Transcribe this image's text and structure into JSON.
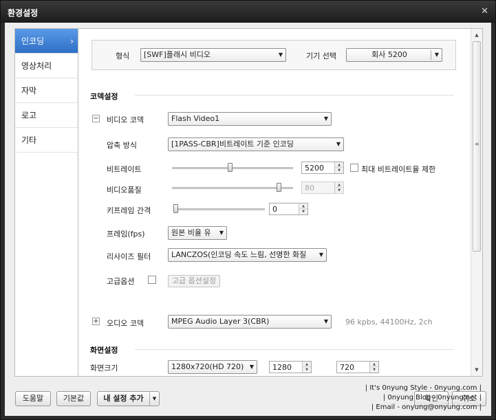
{
  "window": {
    "title": "환경설정",
    "close_icon": "close-icon"
  },
  "sidebar": {
    "items": [
      {
        "label": "인코딩",
        "active": true
      },
      {
        "label": "영상처리"
      },
      {
        "label": "자막"
      },
      {
        "label": "로고"
      },
      {
        "label": "기타"
      }
    ],
    "active_chevron": "›"
  },
  "format": {
    "label": "형식",
    "value": "[SWF]플래시 비디오",
    "device_label": "기기 선택",
    "device_value": "회사 5200"
  },
  "codec_section": {
    "title": "코덱설정",
    "video_codec_toggle": "−",
    "video_codec_label": "비디오 코덱",
    "video_codec_value": "Flash Video1",
    "encoding_method_label": "압축 방식",
    "encoding_method_value": "[1PASS-CBR]비트레이트 기준 인코딩",
    "bitrate_label": "비트레이트",
    "bitrate_value": "5200",
    "bitrate_slider_fraction": 0.48,
    "max_bitrate_label": "최대 비트레이트율 제한",
    "max_bitrate_checked": false,
    "quality_label": "비디오품질",
    "quality_value": "80",
    "quality_slider_fraction": 0.9,
    "keyframe_label": "키프레임 간격",
    "keyframe_value": "0",
    "keyframe_slider_fraction": 0.0,
    "fps_label": "프레임(fps)",
    "fps_value": "원본 비율 유",
    "resize_label": "리사이즈 필터",
    "resize_value": "LANCZOS(인코딩 속도 느림, 선명한 화질",
    "advanced_label": "고급옵션",
    "advanced_checked": false,
    "advanced_button": "고급 옵션설정",
    "audio_codec_toggle": "+",
    "audio_codec_label": "오디오 코덱",
    "audio_codec_value": "MPEG Audio Layer 3(CBR)",
    "audio_info": "96 kpbs, 44100Hz, 2ch"
  },
  "screen_section": {
    "title": "화면설정",
    "size_label": "화면크기",
    "size_value": "1280x720(HD 720)",
    "width_value": "1280",
    "height_value": "720"
  },
  "footer": {
    "help": "도움말",
    "default": "기본값",
    "add_my_settings": "내 설정 추가",
    "confirm": "확인",
    "cancel": "취소"
  },
  "watermark": {
    "line1": "| It's 0nyung Style - 0nyung.com |",
    "line2": "| 0nyung Blog - 0nyung.net |",
    "line3": "| Email - onyung@onyung.com |"
  }
}
